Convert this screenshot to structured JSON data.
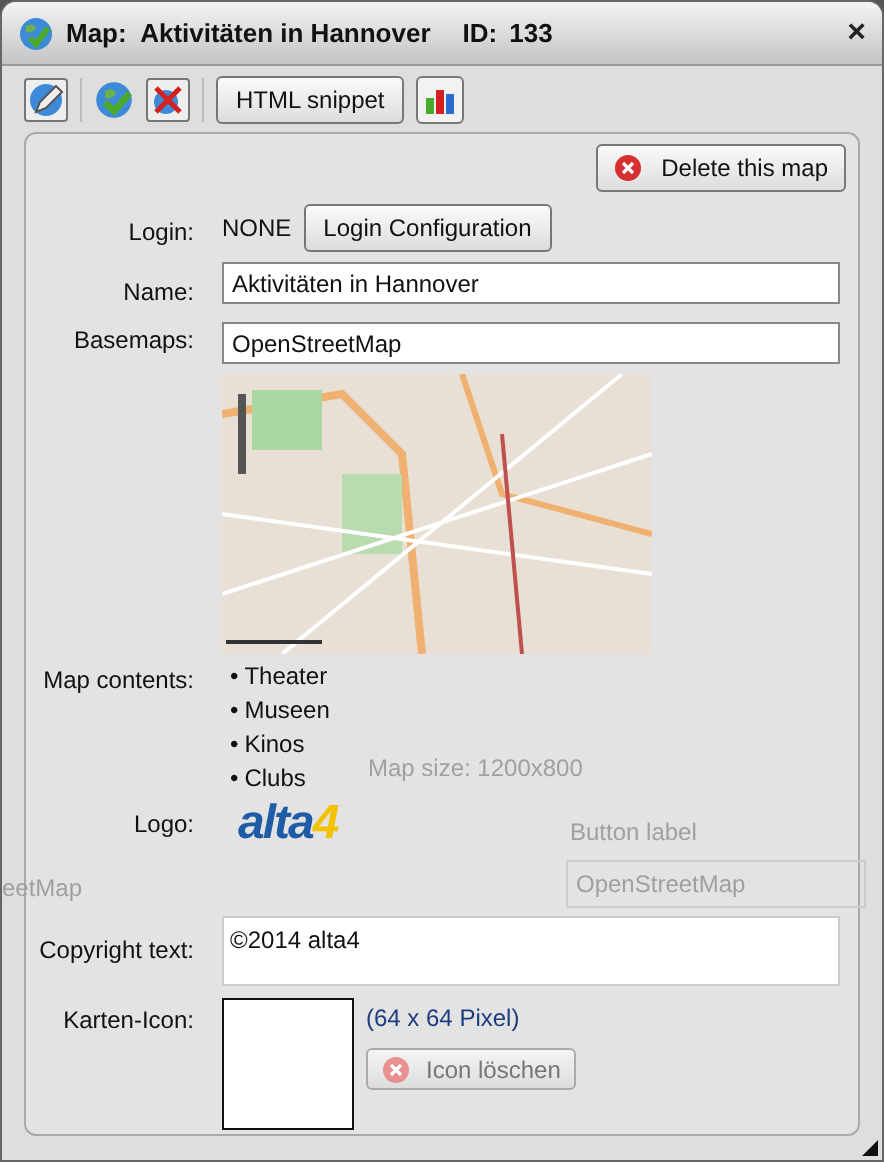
{
  "window": {
    "title": "Map:  Aktivitäten in Hannover",
    "id_label": "ID:",
    "id": "133",
    "close": "×"
  },
  "toolbar": {
    "snippet_button": "HTML snippet"
  },
  "delete_button": "Delete this map",
  "background": {
    "map_size": "Map size: 1200x800",
    "button_label": "Button label",
    "basemap_name": "eetMap",
    "basemap_field": "OpenStreetMap"
  },
  "form": {
    "login_label": "Login:",
    "login_value": "NONE",
    "login_button": "Login Configuration",
    "name_label": "Name:",
    "name_value": "Aktivitäten in Hannover",
    "basemaps_label": "Basemaps:",
    "basemaps_value": "OpenStreetMap",
    "contents_label": "Map contents:",
    "contents": [
      {
        "bullet": "•",
        "text": "Theater"
      },
      {
        "bullet": "•",
        "text": "Museen"
      },
      {
        "bullet": "•",
        "text": "Kinos"
      },
      {
        "bullet": "•",
        "text": "Clubs"
      }
    ],
    "logo_label": "Logo:",
    "logo_parts": [
      "alta",
      "4"
    ],
    "copyright_label": "Copyright text:",
    "copyright_value": "©2014 alta4",
    "icon_label": "Karten-Icon:",
    "icon_size": "(64 x 64 Pixel)",
    "icon_delete_button": {
      "label": "Icon löschen",
      "disabled": true
    }
  }
}
